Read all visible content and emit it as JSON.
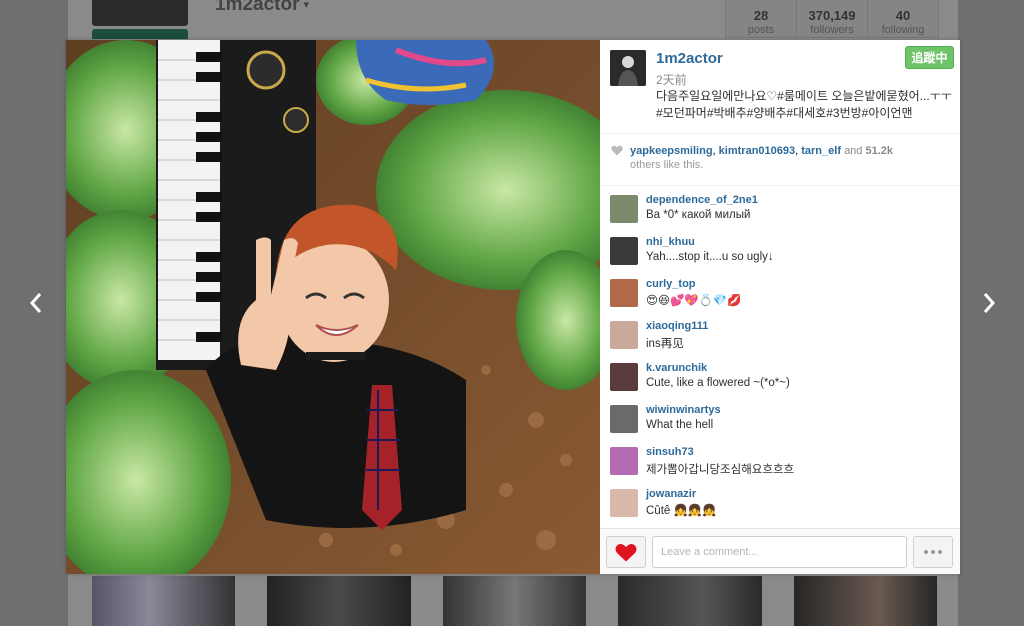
{
  "background": {
    "username": "1m2actor",
    "stats": [
      {
        "value": "28",
        "label": "posts"
      },
      {
        "value": "370,149",
        "label": "followers"
      },
      {
        "value": "40",
        "label": "following"
      }
    ]
  },
  "post": {
    "username": "1m2actor",
    "time": "2天前",
    "follow_label": "追蹤中",
    "caption": "다음주일요일에만나요♡#룸메이트 오늘은밭에묻혔어...ㅜㅜ#모던파머#박배추#양배추#대세호#3번방#아이언맨"
  },
  "likes": {
    "users": [
      "yapkeepsmiling",
      "kimtran010693",
      "tarn_elf"
    ],
    "and_text": "and",
    "count": "51.2k",
    "others_text": "others like this."
  },
  "comments": [
    {
      "user": "dependence_of_2ne1",
      "text": "Ва *0* какой милый",
      "avatar_color": "#7a8a6a"
    },
    {
      "user": "nhi_khuu",
      "text": "Yah....stop it....u so ugly↓",
      "avatar_color": "#3a3a3a"
    },
    {
      "user": "curly_top",
      "text": "😍😆💕💖💍💎💋",
      "avatar_color": "#b06a4a"
    },
    {
      "user": "xiaoqing111",
      "text": "ins再见",
      "avatar_color": "#c9a99a"
    },
    {
      "user": "k.varunchik",
      "text": "Cute, like a flowered ~(*o*~)",
      "avatar_color": "#5a3a3a"
    },
    {
      "user": "wiwinwinartys",
      "text": "What the hell",
      "avatar_color": "#6a6a6a"
    },
    {
      "user": "sinsuh73",
      "text": "제가뽑아갑니당조심해요흐흐흐",
      "avatar_color": "#b36ab3"
    },
    {
      "user": "jowanazir",
      "text": "Cûtê 👧👧👧",
      "avatar_color": "#d8b8a8"
    }
  ],
  "footer": {
    "comment_placeholder": "Leave a comment..."
  },
  "colors": {
    "link": "#2d6a9a",
    "follow_button": "#6fc46a",
    "heart": "#e0141e"
  },
  "icons": [
    "chevron-left-icon",
    "chevron-right-icon",
    "heart-icon",
    "ellipsis-icon"
  ]
}
